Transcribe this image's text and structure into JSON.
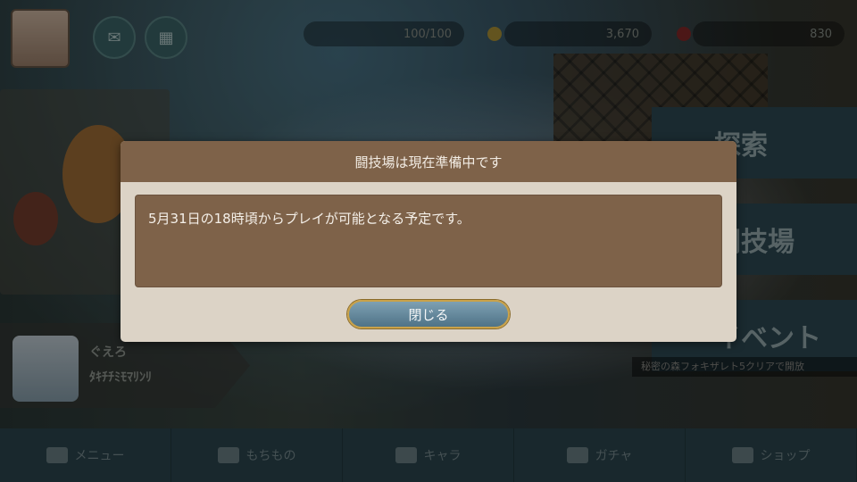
{
  "hud": {
    "stamina": "100/100",
    "currency1": "3,670",
    "currency2": "830"
  },
  "side_menu": {
    "explore": "探索",
    "arena": "闘技場",
    "event": "イベント",
    "event_caption": "秘密の森フォキザレト5クリアで開放"
  },
  "character": {
    "line1": "ぐえろ",
    "line2": "ﾀｷﾁﾁﾐﾓﾏﾘﾝﾘ"
  },
  "bottom_nav": {
    "menu": "メニュー",
    "items": "もちもの",
    "chara": "キャラ",
    "gacha": "ガチャ",
    "shop": "ショップ"
  },
  "dialog": {
    "title": "闘技場は現在準備中です",
    "message": "5月31日の18時頃からプレイが可能となる予定です。",
    "close_label": "閉じる"
  }
}
